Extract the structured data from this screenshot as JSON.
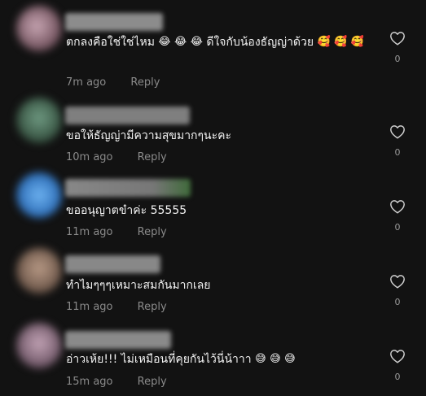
{
  "comments": [
    {
      "text": "ตกลงคือใช่ใช่ไหม",
      "emojis_a": [
        "😂",
        "😂",
        "😂"
      ],
      "text2": "ดีใจกับน้องธัญญ่าด้วย",
      "emojis_b": [
        "🥰",
        "🥰",
        "🥰"
      ],
      "time": "7m ago",
      "reply": "Reply",
      "likes": "0"
    },
    {
      "text": "ขอให้ธัญญ่ามีความสุขมากๆนะคะ",
      "time": "10m ago",
      "reply": "Reply",
      "likes": "0"
    },
    {
      "text": "ขออนุญาตขำค่ะ 55555",
      "time": "11m ago",
      "reply": "Reply",
      "likes": "0"
    },
    {
      "text": "ทำไมๆๆๆเหมาะสมกันมากเลย",
      "time": "11m ago",
      "reply": "Reply",
      "likes": "0"
    },
    {
      "text": "อ่าวเห้ย!!! ไม่เหมือนที่คุยกันไว้นี่น้าาา",
      "emojis_a": [
        "😅",
        "😅",
        "😅"
      ],
      "time": "15m ago",
      "reply": "Reply",
      "likes": "0"
    }
  ],
  "colors": {
    "background": "#121212",
    "meta_text": "#8a8a8a",
    "heart_outline": "#d0d0d0"
  },
  "icons": {
    "like": "heart-outline-icon"
  }
}
